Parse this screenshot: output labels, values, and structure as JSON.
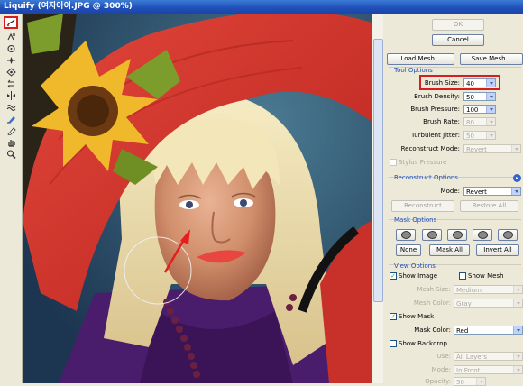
{
  "window": {
    "title": "Liquify (여자아이.JPG @ 300%)"
  },
  "toolbar": {
    "tools": [
      {
        "name": "forward-warp-tool-icon",
        "selected": true
      },
      {
        "name": "reconstruct-tool-icon"
      },
      {
        "name": "twirl-clockwise-tool-icon"
      },
      {
        "name": "pucker-tool-icon"
      },
      {
        "name": "bloat-tool-icon"
      },
      {
        "name": "push-left-tool-icon"
      },
      {
        "name": "mirror-tool-icon"
      },
      {
        "name": "turbulence-tool-icon"
      },
      {
        "name": "freeze-mask-tool-icon"
      },
      {
        "name": "thaw-mask-tool-icon"
      },
      {
        "name": "hand-tool-icon"
      },
      {
        "name": "zoom-tool-icon"
      }
    ],
    "highlight_color": "#d51e1e"
  },
  "buttons": {
    "ok": "OK",
    "cancel": "Cancel",
    "load_mesh": "Load Mesh...",
    "save_mesh": "Save Mesh..."
  },
  "tool_options": {
    "title": "Tool Options",
    "brush_size": {
      "label": "Brush Size:",
      "value": "40"
    },
    "brush_density": {
      "label": "Brush Density:",
      "value": "50"
    },
    "brush_pressure": {
      "label": "Brush Pressure:",
      "value": "100"
    },
    "brush_rate": {
      "label": "Brush Rate:",
      "value": "80"
    },
    "turbulent_jitter": {
      "label": "Turbulent Jitter:",
      "value": "50"
    },
    "reconstruct_mode": {
      "label": "Reconstruct Mode:",
      "value": "Revert"
    },
    "stylus_pressure": "Stylus Pressure"
  },
  "reconstruct_options": {
    "title": "Reconstruct Options",
    "mode": {
      "label": "Mode:",
      "value": "Revert"
    },
    "reconstruct": "Reconstruct",
    "restore_all": "Restore All"
  },
  "mask_options": {
    "title": "Mask Options",
    "none": "None",
    "mask_all": "Mask All",
    "invert_all": "Invert All"
  },
  "view_options": {
    "title": "View Options",
    "show_image": "Show Image",
    "show_mesh": "Show Mesh",
    "mesh_size": {
      "label": "Mesh Size:",
      "value": "Medium"
    },
    "mesh_color": {
      "label": "Mesh Color:",
      "value": "Gray"
    },
    "show_mask": "Show Mask",
    "mask_color": {
      "label": "Mask Color:",
      "value": "Red"
    },
    "show_backdrop": "Show Backdrop",
    "use": {
      "label": "Use:",
      "value": "All Layers"
    },
    "mode": {
      "label": "Mode:",
      "value": "In Front"
    },
    "opacity": {
      "label": "Opacity:",
      "value": "50"
    }
  }
}
